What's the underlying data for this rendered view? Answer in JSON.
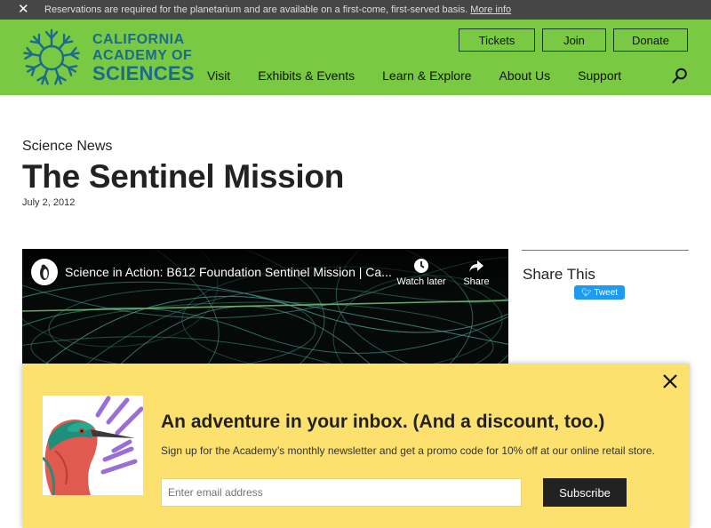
{
  "alert": {
    "message": "Reservations are required for the planetarium and are available on a first-come, first-served basis.",
    "link": "More info"
  },
  "logo": {
    "line1": "CALIFORNIA",
    "line2": "ACADEMY OF",
    "line3": "SCIENCES"
  },
  "top_buttons": {
    "tickets": "Tickets",
    "join": "Join",
    "donate": "Donate"
  },
  "nav": [
    "Visit",
    "Exhibits & Events",
    "Learn & Explore",
    "About Us",
    "Support"
  ],
  "article": {
    "eyebrow": "Science News",
    "title": "The Sentinel Mission",
    "date": "July 2, 2012"
  },
  "video": {
    "title": "Science in Action: B612 Foundation Sentinel Mission | Ca...",
    "watch_later": "Watch later",
    "share": "Share"
  },
  "share": {
    "title": "Share This",
    "tweet": "Tweet"
  },
  "newsletter": {
    "title": "An adventure in your inbox. (And a discount, too.)",
    "text": "Sign up for the Academy’s monthly newsletter and get a promo code for 10% off at our online retail store.",
    "placeholder": "Enter email address",
    "button": "Subscribe"
  },
  "colors": {
    "header_green": "#7ac943",
    "logo_blue": "#1b6b8c",
    "alert_gray": "#464646",
    "promo_yellow": "#fde16e",
    "tweet_blue": "#1d9bf0"
  }
}
